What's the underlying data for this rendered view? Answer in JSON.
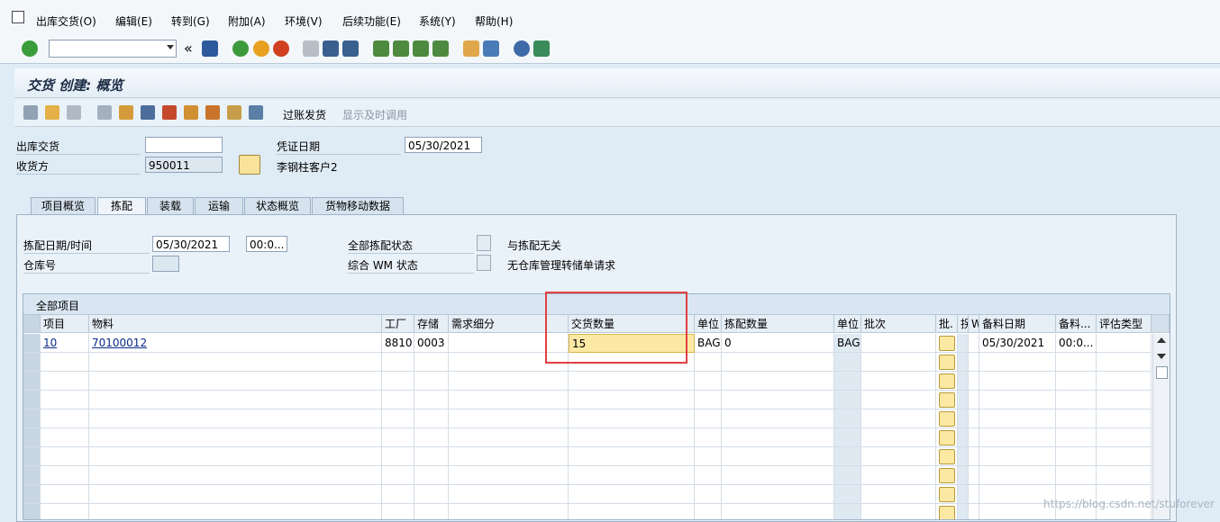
{
  "menu": [
    "出库交货(O)",
    "编辑(E)",
    "转到(G)",
    "附加(A)",
    "环境(V)",
    "后续功能(E)",
    "系统(Y)",
    "帮助(H)"
  ],
  "toolbar": {
    "command_field_value": "",
    "back_label": "«"
  },
  "title": "交货 创建: 概览",
  "app_toolbar": {
    "post_goods_issue": "过账发货",
    "display_timely": "显示及时调用"
  },
  "header": {
    "outbound_delivery_label": "出库交货",
    "outbound_delivery_value": "",
    "ship_to_label": "收货方",
    "ship_to_value": "950011",
    "document_date_label": "凭证日期",
    "document_date_value": "05/30/2021",
    "customer_name": "李钢柱客户2"
  },
  "tabs": [
    "项目概览",
    "拣配",
    "装载",
    "运输",
    "状态概览",
    "货物移动数据"
  ],
  "picking": {
    "date_time_label": "拣配日期/时间",
    "date_value": "05/30/2021",
    "time_value": "00:0...",
    "warehouse_label": "仓库号",
    "overall_pick_status_label": "全部拣配状态",
    "overall_pick_status_text": "与拣配无关",
    "overall_wm_status_label": "综合 WM 状态",
    "overall_wm_status_text": "无仓库管理转储单请求"
  },
  "table": {
    "title": "全部项目",
    "columns": [
      "项目",
      "物料",
      "工厂",
      "存储",
      "需求细分",
      "交货数量",
      "单位",
      "拣配数量",
      "单位",
      "批次",
      "批.",
      "拐",
      "W",
      "备料日期",
      "备料...",
      "评估类型"
    ],
    "rows": [
      {
        "item": "10",
        "material": "70100012",
        "plant": "8810",
        "storage": "0003",
        "req_seg": "",
        "delivery_qty": "15",
        "unit": "BAG",
        "pick_qty": "0",
        "unit2": "BAG",
        "batch": "",
        "avail_date": "05/30/2021",
        "avail_time": "00:0...",
        "valuation": ""
      }
    ]
  },
  "watermark": "https://blog.csdn.net/stuforever"
}
